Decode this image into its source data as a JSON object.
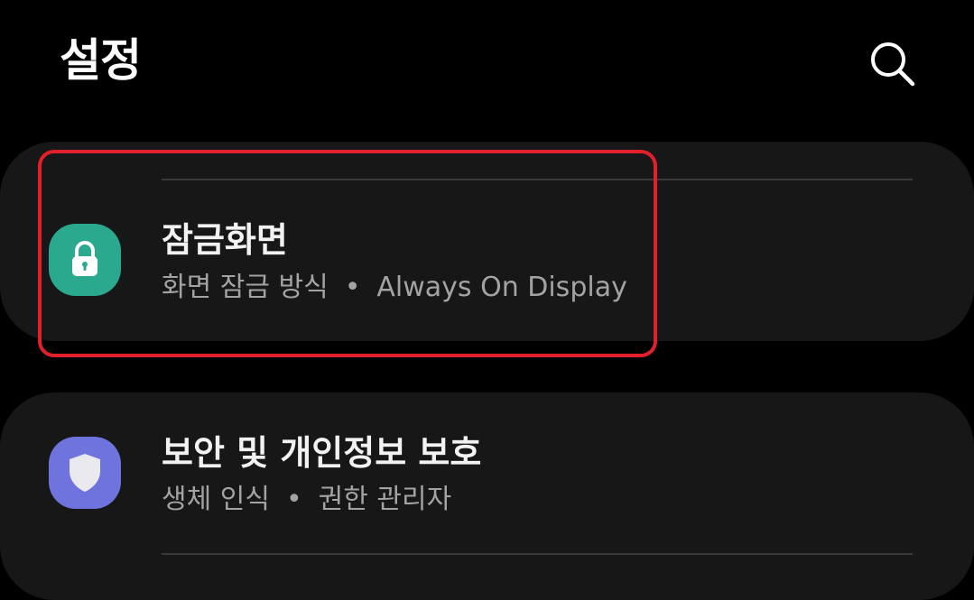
{
  "header": {
    "title": "설정",
    "search_icon": "search-icon"
  },
  "cards": [
    {
      "title": "잠금화면",
      "subtitle_parts": [
        "화면 잠금 방식",
        "Always On Display"
      ],
      "icon": "lock-icon",
      "icon_bg": "#2aa98f",
      "highlighted": true
    },
    {
      "title": "보안 및 개인정보 보호",
      "subtitle_parts": [
        "생체 인식",
        "권한 관리자"
      ],
      "icon": "shield-icon",
      "icon_bg": "#6f73de"
    }
  ],
  "separator": "•",
  "colors": {
    "background": "#000000",
    "card": "#171717",
    "highlight_border": "#e2202b",
    "subtitle": "#a3a3a3"
  }
}
